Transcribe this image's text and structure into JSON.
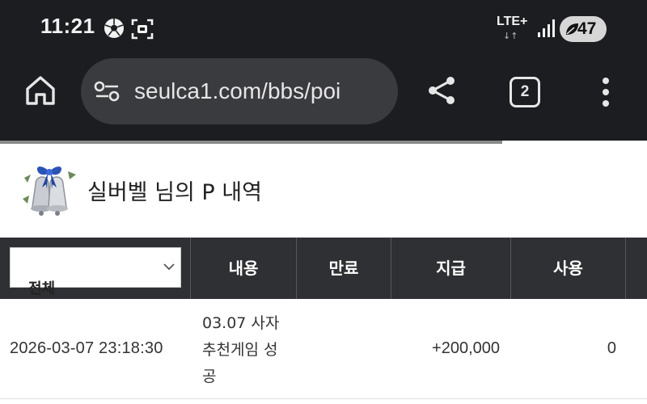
{
  "status_bar": {
    "time": "11:21",
    "network": "LTE+",
    "network_arrows": "↓↑",
    "battery": "47",
    "icons": [
      "soccer-ball-icon",
      "screen-capture-icon",
      "signal-icon",
      "battery-saver-icon"
    ]
  },
  "browser": {
    "url": "seulca1.com/bbs/poi",
    "tab_count": "2",
    "icons": [
      "home-icon",
      "site-settings-icon",
      "share-icon",
      "tabs-icon",
      "more-vert-icon"
    ]
  },
  "page": {
    "title": "실버벨 님의 P 내역",
    "title_icon": "silver-bell-icon"
  },
  "table": {
    "filter": {
      "selected": "전체"
    },
    "columns": [
      "내용",
      "만료",
      "지급",
      "사용"
    ],
    "rows": [
      {
        "date": "2026-03-07 23:18:30",
        "content": "03.07 사자 추천게임 성공",
        "expiry": "",
        "payment": "+200,000",
        "used": "0"
      }
    ]
  },
  "colors": {
    "chrome_bg": "#1b1d20",
    "url_bg": "#3a3b3f",
    "header_bg": "#2f3033",
    "text": "#333333"
  }
}
